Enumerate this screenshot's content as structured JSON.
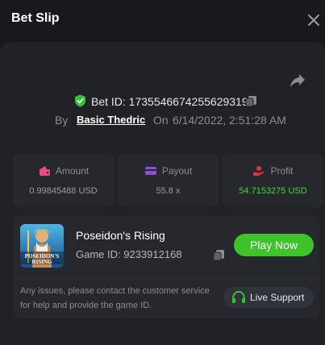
{
  "header": {
    "title": "Bet Slip"
  },
  "bet": {
    "id_label": "Bet ID: 1735546674255629319",
    "by_label": "By",
    "user": "Basic Thedric",
    "on_label": "On",
    "date": "6/14/2022, 2:51:28 AM"
  },
  "stats": [
    {
      "label": "Amount",
      "value": "0.99845488 USD",
      "icon": "wallet-icon",
      "color": "#e64d7a"
    },
    {
      "label": "Payout",
      "value": "55.8 x",
      "icon": "card-icon",
      "color": "#8b4fd8"
    },
    {
      "label": "Profit",
      "value": "54.7153275 USD",
      "icon": "profit-icon",
      "color": "#e0343b"
    }
  ],
  "game": {
    "name": "Poseidon's Rising",
    "id_label": "Game ID: 9233912168",
    "thumb_text": "POSEIDON'S RISING",
    "play_label": "Play Now"
  },
  "support": {
    "help_text": "Any issues, please contact the customer service for help and provide the game ID.",
    "button_label": "Live Support"
  },
  "colors": {
    "accent_green": "#3ec32c",
    "profit_green": "#3ddc2e"
  }
}
